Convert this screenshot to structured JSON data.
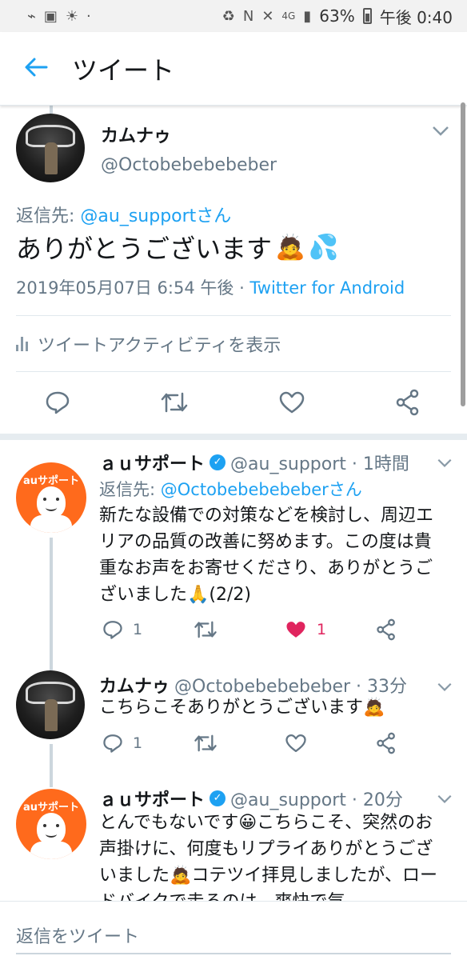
{
  "status_bar": {
    "battery": "63%",
    "time": "午後 0:40",
    "network": "4G",
    "left_icons": [
      "activity-icon",
      "bus-icon",
      "weather-icon"
    ],
    "right_icons": [
      "recycle-icon",
      "nfc-icon",
      "mute-icon",
      "signal-icon",
      "battery-icon"
    ]
  },
  "app_bar": {
    "title": "ツイート",
    "back_icon": "arrow-left"
  },
  "main_tweet": {
    "name": "カムナゥ",
    "handle": "@Octobebebebeber",
    "reply_prefix": "返信先: ",
    "reply_mention": "@au_supportさん",
    "text": "ありがとうございます",
    "emojis": [
      "🙇",
      "💦"
    ],
    "timestamp": "2019年05月07日 6:54 午後 · ",
    "source": "Twitter for Android",
    "activity_label": "ツイートアクティビティを表示"
  },
  "replies": [
    {
      "name": "ａｕサポート",
      "verified": true,
      "handle": "@au_support · 1時間",
      "reply_prefix": "返信先: ",
      "reply_mention": "@Octobebebebeberさん",
      "text": "新たな設備での対策などを検討し、周辺エリアの品質の改善に努めます。この度は貴重なお声をお寄せくださり、ありがとうございました🙏(2/2)",
      "reply_count": "1",
      "like_count": "1",
      "liked": true
    },
    {
      "name": "カムナゥ",
      "handle": "@Octobebebebeber · 33分",
      "text": "こちらこそありがとうございます🙇",
      "reply_count": "1"
    },
    {
      "name": "ａｕサポート",
      "verified": true,
      "handle": "@au_support · 20分",
      "text": "とんでもないです😀こちらこそ、突然のお声掛けに、何度もリプライありがとうございました🙇コテツイ拝見しましたが、ロードバイクで走るのは、爽快で気"
    }
  ],
  "composer": {
    "placeholder": "返信をツイート"
  },
  "colors": {
    "accent": "#1da1f2",
    "like": "#e0245e",
    "au_orange": "#ff6a1c",
    "secondary_text": "#657786"
  }
}
